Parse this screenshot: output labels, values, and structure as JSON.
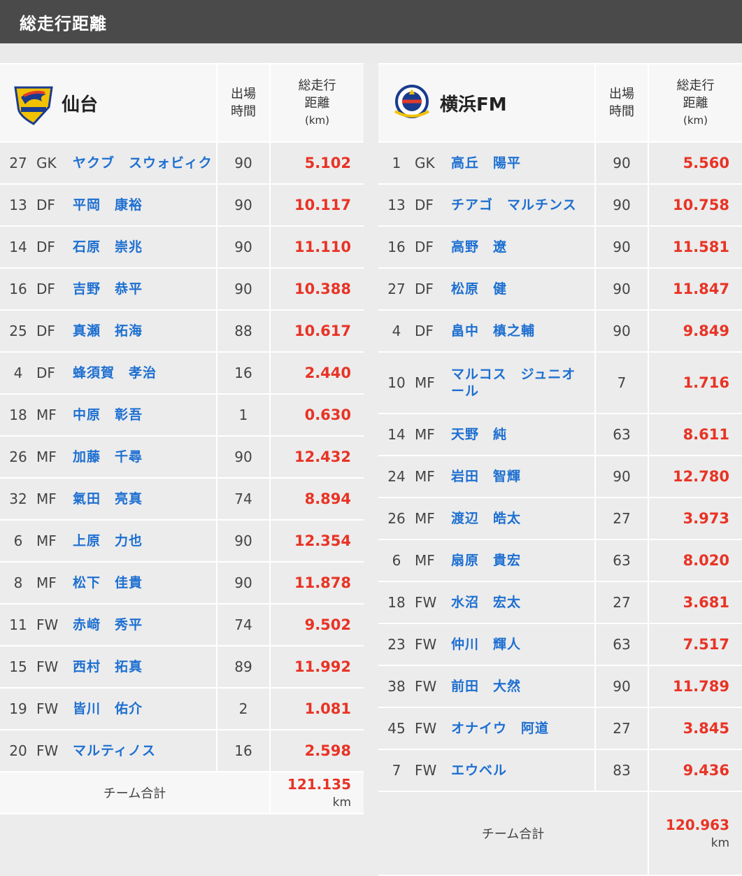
{
  "page_title": "総走行距離",
  "headers": {
    "minutes_line1": "出場",
    "minutes_line2": "時間",
    "dist_line1": "総走行",
    "dist_line2": "距離",
    "dist_unit": "(km)"
  },
  "total_label": "チーム合計",
  "total_unit": "km",
  "colors": {
    "title_bar": "#4a4a4a",
    "player_name": "#1d6fd1",
    "distance": "#e83325"
  },
  "teams": [
    {
      "name": "仙台",
      "total": "121.135",
      "players": [
        {
          "no": "27",
          "pos": "GK",
          "name": "ヤクブ　スウォビィク",
          "min": "90",
          "dist": "5.102"
        },
        {
          "no": "13",
          "pos": "DF",
          "name": "平岡　康裕",
          "min": "90",
          "dist": "10.117"
        },
        {
          "no": "14",
          "pos": "DF",
          "name": "石原　崇兆",
          "min": "90",
          "dist": "11.110"
        },
        {
          "no": "16",
          "pos": "DF",
          "name": "吉野　恭平",
          "min": "90",
          "dist": "10.388"
        },
        {
          "no": "25",
          "pos": "DF",
          "name": "真瀬　拓海",
          "min": "88",
          "dist": "10.617"
        },
        {
          "no": "4",
          "pos": "DF",
          "name": "蜂須賀　孝治",
          "min": "16",
          "dist": "2.440"
        },
        {
          "no": "18",
          "pos": "MF",
          "name": "中原　彰吾",
          "min": "1",
          "dist": "0.630"
        },
        {
          "no": "26",
          "pos": "MF",
          "name": "加藤　千尋",
          "min": "90",
          "dist": "12.432"
        },
        {
          "no": "32",
          "pos": "MF",
          "name": "氣田　亮真",
          "min": "74",
          "dist": "8.894"
        },
        {
          "no": "6",
          "pos": "MF",
          "name": "上原　力也",
          "min": "90",
          "dist": "12.354"
        },
        {
          "no": "8",
          "pos": "MF",
          "name": "松下　佳貴",
          "min": "90",
          "dist": "11.878"
        },
        {
          "no": "11",
          "pos": "FW",
          "name": "赤﨑　秀平",
          "min": "74",
          "dist": "9.502"
        },
        {
          "no": "15",
          "pos": "FW",
          "name": "西村　拓真",
          "min": "89",
          "dist": "11.992"
        },
        {
          "no": "19",
          "pos": "FW",
          "name": "皆川　佑介",
          "min": "2",
          "dist": "1.081"
        },
        {
          "no": "20",
          "pos": "FW",
          "name": "マルティノス",
          "min": "16",
          "dist": "2.598"
        }
      ]
    },
    {
      "name": "横浜FM",
      "total": "120.963",
      "players": [
        {
          "no": "1",
          "pos": "GK",
          "name": "高丘　陽平",
          "min": "90",
          "dist": "5.560"
        },
        {
          "no": "13",
          "pos": "DF",
          "name": "チアゴ　マルチンス",
          "min": "90",
          "dist": "10.758"
        },
        {
          "no": "16",
          "pos": "DF",
          "name": "高野　遼",
          "min": "90",
          "dist": "11.581"
        },
        {
          "no": "27",
          "pos": "DF",
          "name": "松原　健",
          "min": "90",
          "dist": "11.847"
        },
        {
          "no": "4",
          "pos": "DF",
          "name": "畠中　槙之輔",
          "min": "90",
          "dist": "9.849"
        },
        {
          "no": "10",
          "pos": "MF",
          "name": "マルコス　ジュニオール",
          "min": "7",
          "dist": "1.716"
        },
        {
          "no": "14",
          "pos": "MF",
          "name": "天野　純",
          "min": "63",
          "dist": "8.611"
        },
        {
          "no": "24",
          "pos": "MF",
          "name": "岩田　智輝",
          "min": "90",
          "dist": "12.780"
        },
        {
          "no": "26",
          "pos": "MF",
          "name": "渡辺　皓太",
          "min": "27",
          "dist": "3.973"
        },
        {
          "no": "6",
          "pos": "MF",
          "name": "扇原　貴宏",
          "min": "63",
          "dist": "8.020"
        },
        {
          "no": "18",
          "pos": "FW",
          "name": "水沼　宏太",
          "min": "27",
          "dist": "3.681"
        },
        {
          "no": "23",
          "pos": "FW",
          "name": "仲川　輝人",
          "min": "63",
          "dist": "7.517"
        },
        {
          "no": "38",
          "pos": "FW",
          "name": "前田　大然",
          "min": "90",
          "dist": "11.789"
        },
        {
          "no": "45",
          "pos": "FW",
          "name": "オナイウ　阿道",
          "min": "27",
          "dist": "3.845"
        },
        {
          "no": "7",
          "pos": "FW",
          "name": "エウベル",
          "min": "83",
          "dist": "9.436"
        }
      ]
    }
  ]
}
